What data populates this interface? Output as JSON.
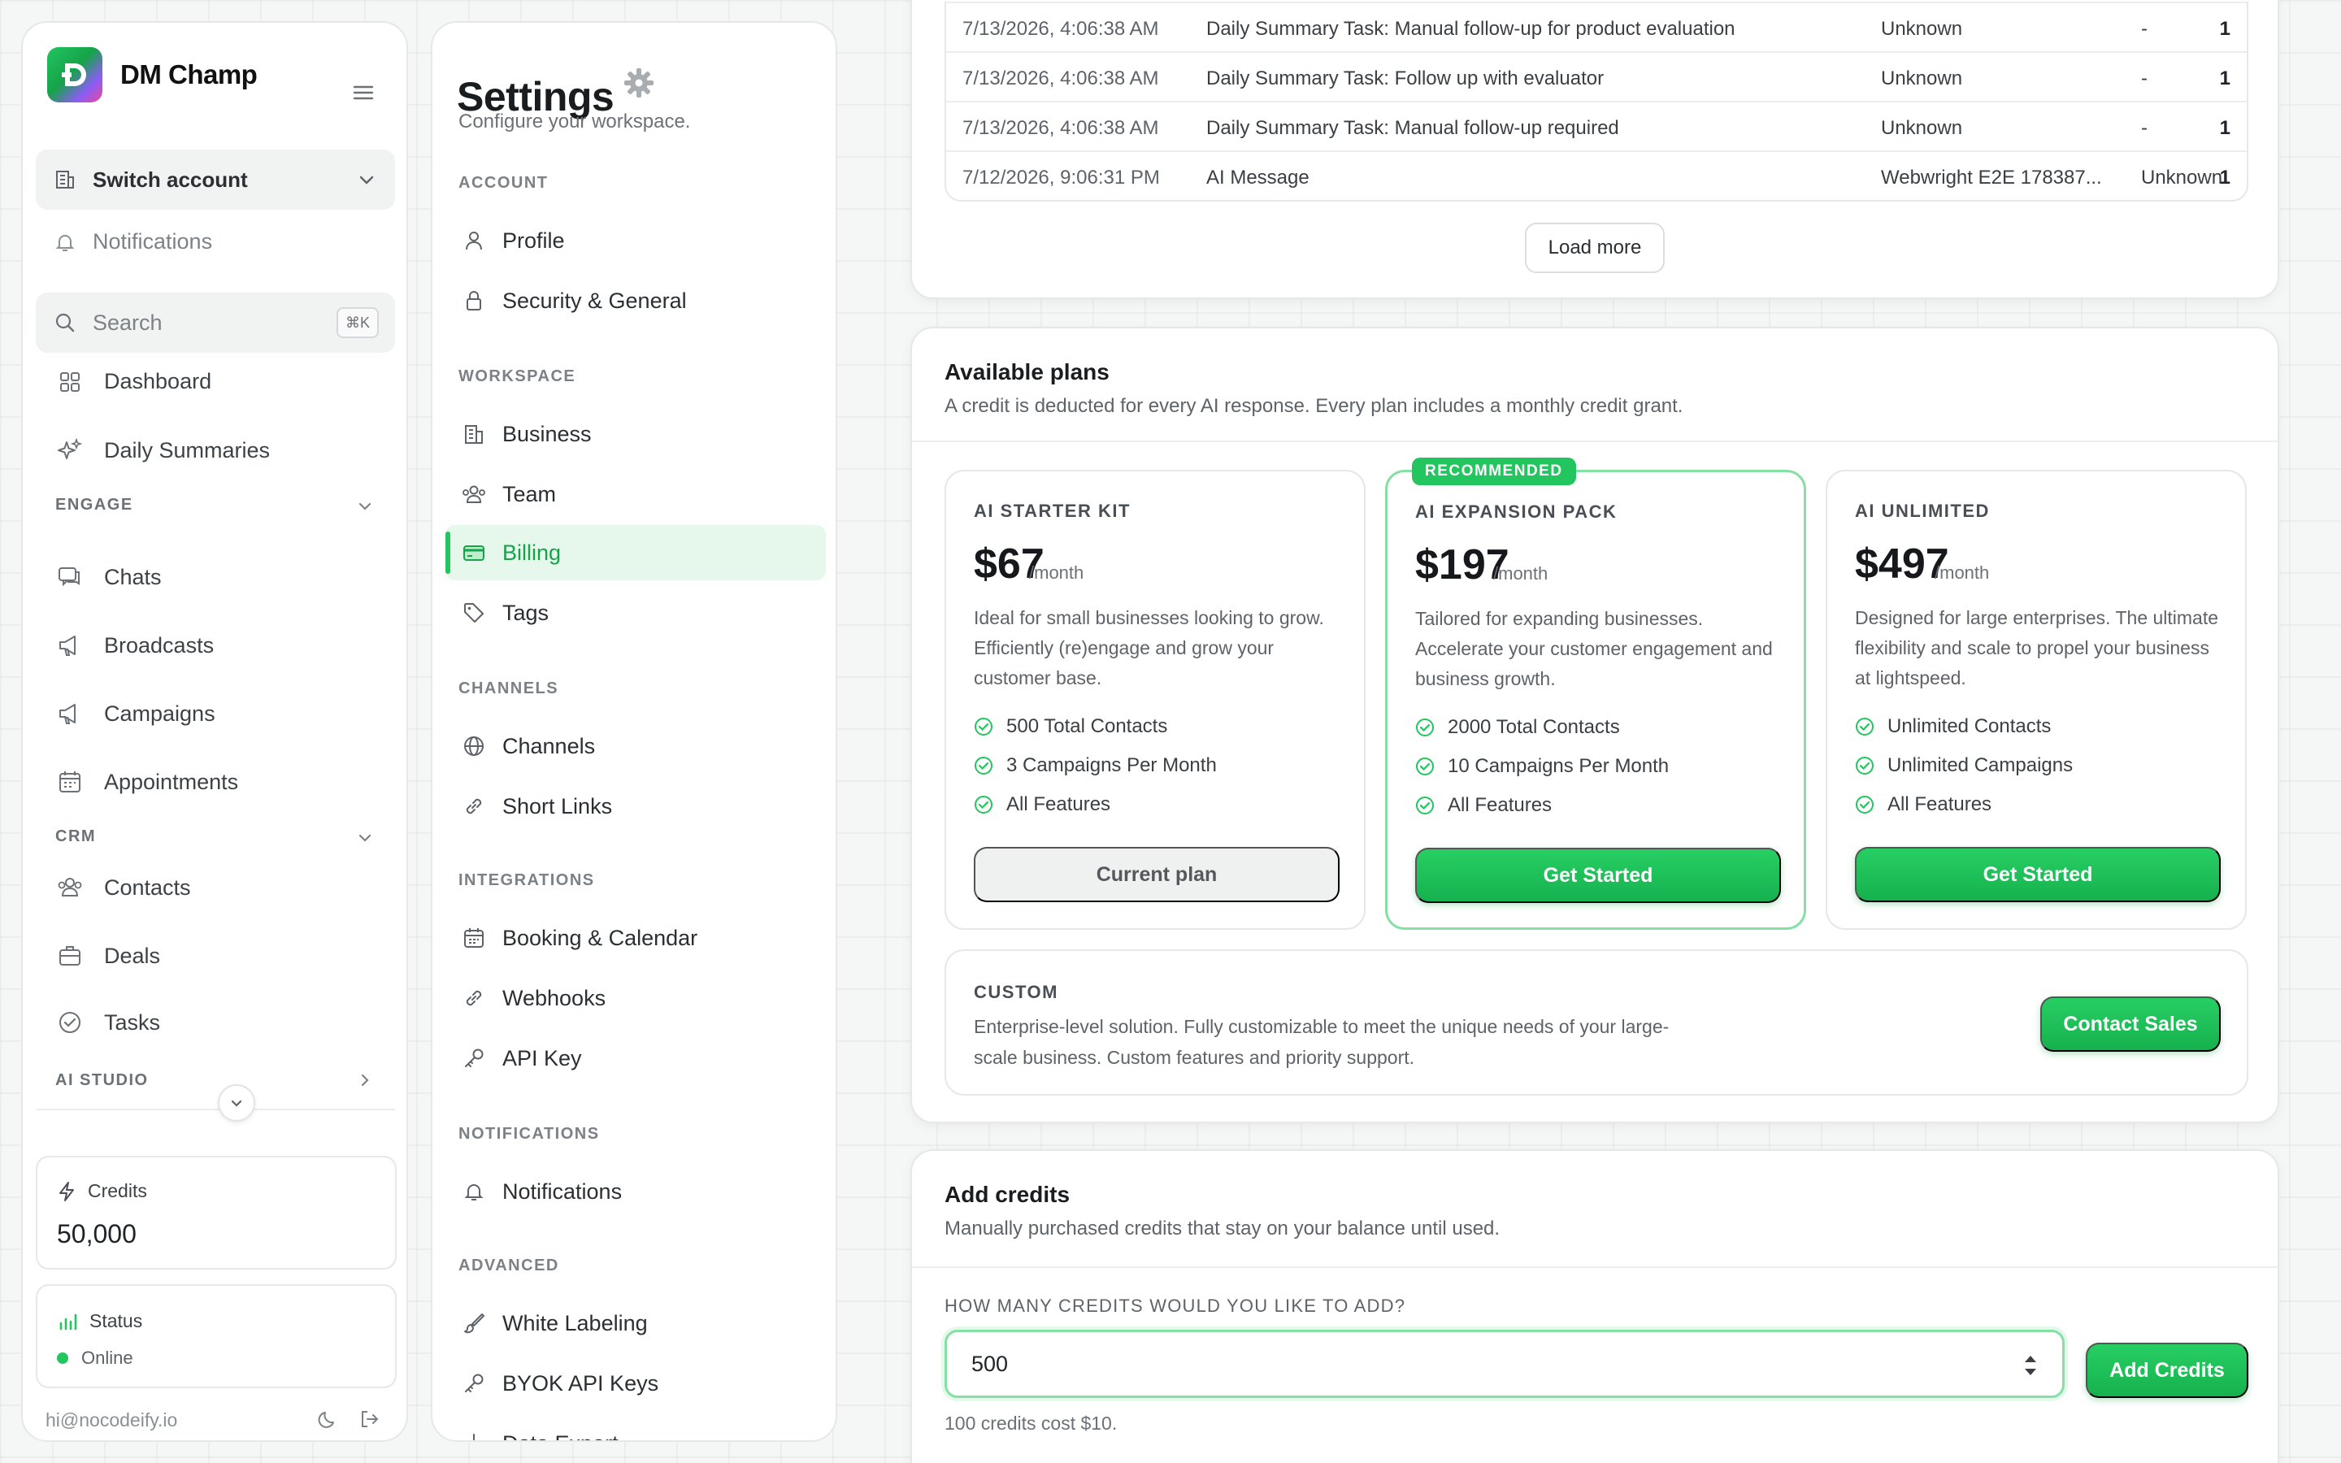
{
  "brand": {
    "name": "DM Champ"
  },
  "sidebar": {
    "switch_account": "Switch account",
    "notifications": "Notifications",
    "search_placeholder": "Search",
    "search_shortcut": "⌘K",
    "items": [
      {
        "label": "Dashboard",
        "icon": "grid-icon"
      },
      {
        "label": "Daily Summaries",
        "icon": "sparkles-icon"
      }
    ],
    "engage_label": "ENGAGE",
    "engage_items": [
      {
        "label": "Chats",
        "icon": "chat-icon"
      },
      {
        "label": "Broadcasts",
        "icon": "megaphone-icon"
      },
      {
        "label": "Campaigns",
        "icon": "megaphone-icon"
      },
      {
        "label": "Appointments",
        "icon": "calendar-icon"
      }
    ],
    "crm_label": "CRM",
    "crm_items": [
      {
        "label": "Contacts",
        "icon": "users-icon"
      },
      {
        "label": "Deals",
        "icon": "briefcase-icon"
      },
      {
        "label": "Tasks",
        "icon": "check-circle-icon"
      }
    ],
    "ai_studio_label": "AI STUDIO",
    "credits_label": "Credits",
    "credits_value": "50,000",
    "status_label": "Status",
    "status_value": "Online",
    "user_email": "hi@nocodeify.io"
  },
  "settings": {
    "title": "Settings",
    "subtitle": "Configure your workspace.",
    "sections": {
      "account": "ACCOUNT",
      "workspace": "WORKSPACE",
      "channels": "CHANNELS",
      "integrations": "INTEGRATIONS",
      "notifications": "NOTIFICATIONS",
      "advanced": "ADVANCED"
    },
    "items": {
      "profile": "Profile",
      "security": "Security & General",
      "business": "Business",
      "team": "Team",
      "billing": "Billing",
      "tags": "Tags",
      "channels": "Channels",
      "short_links": "Short Links",
      "booking": "Booking & Calendar",
      "webhooks": "Webhooks",
      "api_key": "API Key",
      "notifications": "Notifications",
      "white_labeling": "White Labeling",
      "byok": "BYOK API Keys",
      "data_export": "Data Export"
    }
  },
  "transactions": {
    "rows": [
      {
        "date": "7/13/2026, 4:06:38 AM",
        "desc": "Daily Summary Task: Manual follow-up for product evaluation",
        "contact": "Unknown",
        "status": "-",
        "amount": "1"
      },
      {
        "date": "7/13/2026, 4:06:38 AM",
        "desc": "Daily Summary Task: Follow up with evaluator",
        "contact": "Unknown",
        "status": "-",
        "amount": "1"
      },
      {
        "date": "7/13/2026, 4:06:38 AM",
        "desc": "Daily Summary Task: Manual follow-up required",
        "contact": "Unknown",
        "status": "-",
        "amount": "1"
      },
      {
        "date": "7/12/2026, 9:06:31 PM",
        "desc": "AI Message",
        "contact": "Webwright E2E 178387...",
        "status": "Unknown",
        "amount": "1"
      }
    ],
    "load_more": "Load more"
  },
  "plans": {
    "title": "Available plans",
    "description": "A credit is deducted for every AI response. Every plan includes a monthly credit grant.",
    "recommended_badge": "RECOMMENDED",
    "per": "/month",
    "items": [
      {
        "name": "AI STARTER KIT",
        "price": "$67",
        "description": "Ideal for small businesses looking to grow. Efficiently (re)engage and grow your customer base.",
        "features": [
          "500 Total Contacts",
          "3 Campaigns Per Month",
          "All Features"
        ],
        "button": "Current plan"
      },
      {
        "name": "AI EXPANSION PACK",
        "price": "$197",
        "description": "Tailored for expanding businesses. Accelerate your customer engagement and business growth.",
        "features": [
          "2000 Total Contacts",
          "10 Campaigns Per Month",
          "All Features"
        ],
        "button": "Get Started"
      },
      {
        "name": "AI UNLIMITED",
        "price": "$497",
        "description": "Designed for large enterprises. The ultimate flexibility and scale to propel your business at lightspeed.",
        "features": [
          "Unlimited Contacts",
          "Unlimited Campaigns",
          "All Features"
        ],
        "button": "Get Started"
      }
    ],
    "custom": {
      "name": "CUSTOM",
      "description": "Enterprise-level solution. Fully customizable to meet the unique needs of your large-scale business. Custom features and priority support.",
      "button": "Contact Sales"
    }
  },
  "add_credits": {
    "title": "Add credits",
    "description": "Manually purchased credits that stay on your balance until used.",
    "question": "HOW MANY CREDITS WOULD YOU LIKE TO ADD?",
    "value": "500",
    "button": "Add Credits",
    "note": "100 credits cost $10."
  },
  "colors": {
    "accent": "#22c55e",
    "accent_dark": "#16a34a",
    "active_bg": "#e6f7eb",
    "border": "#e6e8e7"
  }
}
